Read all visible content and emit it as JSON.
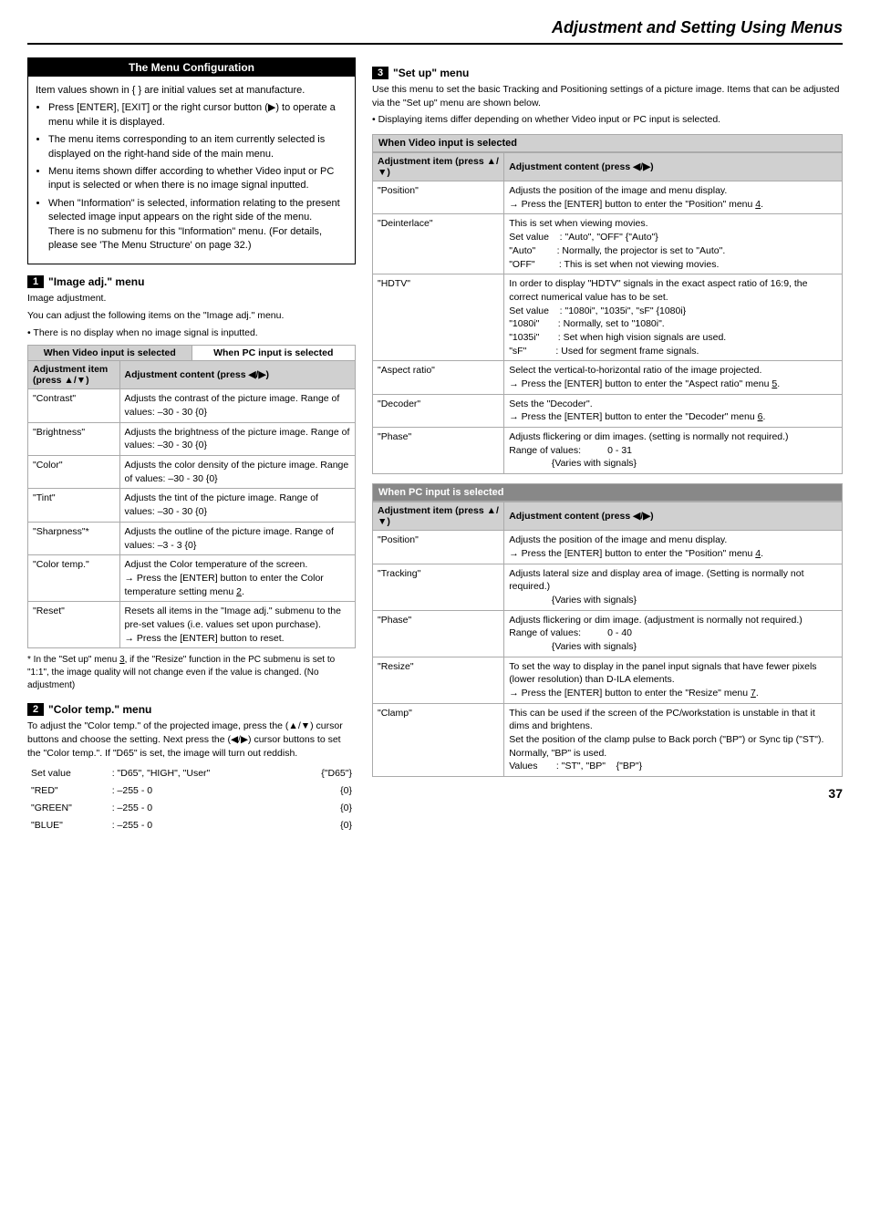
{
  "page": {
    "title": "Adjustment and Setting Using Menus",
    "number": "37"
  },
  "menu_config": {
    "title": "The Menu Configuration",
    "body_para": "Item values shown in {  } are initial values set at manufacture.",
    "bullets": [
      "Press [ENTER], [EXIT] or the right cursor button (▶) to operate a menu while it is displayed.",
      "The menu items corresponding to an item currently selected is displayed on the right-hand side of the main menu.",
      "Menu items shown differ according to whether Video input or PC input is selected or when there is no image signal inputted.",
      "When \"Information\" is selected, information relating to the present selected image input appears on the right side of the menu.",
      "There is no submenu for this \"Information\" menu. (For details, please see 'The Menu Structure' on page 32.)"
    ]
  },
  "menu1": {
    "num": "1",
    "title": "\"Image adj.\" menu",
    "desc": "Image adjustment.",
    "sub": "You can adjust the following items on the \"Image adj.\" menu.",
    "bullet": "There is no display when no image signal is inputted.",
    "tab_video": "When Video input is selected",
    "tab_pc": "When PC input is selected",
    "col1": "Adjustment item (press ▲/▼)",
    "col2": "Adjustment content (press ◀/▶)",
    "rows": [
      {
        "item": "\"Contrast\"",
        "content": "Adjusts the contrast of the picture image. Range of values: –30 - 30    {0}"
      },
      {
        "item": "\"Brightness\"",
        "content": "Adjusts the brightness of the picture image. Range of values: –30 - 30    {0}"
      },
      {
        "item": "\"Color\"",
        "content": "Adjusts the color density of the picture image. Range of values: –30 - 30    {0}"
      },
      {
        "item": "\"Tint\"",
        "content": "Adjusts the tint of the picture image. Range of values: –30 - 30    {0}"
      },
      {
        "item": "\"Sharpness\"*",
        "content": "Adjusts the outline of the picture image. Range of values: –3 - 3    {0}"
      },
      {
        "item": "\"Color temp.\"",
        "content": "Adjust the Color temperature of the screen.\n→ Press the [ENTER] button to enter the Color temperature setting menu 2."
      },
      {
        "item": "\"Reset\"",
        "content": "Resets all items in the \"Image adj.\" submenu to the pre-set values (i.e. values set upon purchase).\n→ Press the [ENTER] button to reset."
      }
    ],
    "footnote": "* In the \"Set up\" menu 3, if the \"Resize\" function in the PC submenu is set to \"1:1\", the image quality will not change even if the value is changed. (No adjustment)"
  },
  "menu2": {
    "num": "2",
    "title": "\"Color temp.\" menu",
    "desc": "To adjust the \"Color temp.\" of the projected image, press the (▲/▼) cursor buttons and choose the setting. Next press the (◀/▶) cursor buttons to set the \"Color temp.\". If \"D65\" is set, the image will turn out reddish.",
    "set_value_label": "Set value",
    "set_value": ": \"D65\", \"HIGH\", \"User\"",
    "set_value_suffix": "{\"D65\"}",
    "red_label": "\"RED\"",
    "red_value": ": –255 - 0",
    "red_suffix": "{0}",
    "green_label": "\"GREEN\"",
    "green_value": ": –255 - 0",
    "green_suffix": "{0}",
    "blue_label": "\"BLUE\"",
    "blue_value": ": –255 - 0",
    "blue_suffix": "{0}"
  },
  "menu3": {
    "num": "3",
    "title": "\"Set up\" menu",
    "desc": "Use this menu to set the basic Tracking and Positioning settings of a picture image. Items that can be adjusted via the \"Set up\" menu are shown below.",
    "bullet": "Displaying items differ depending on whether Video input or PC input is selected.",
    "when_video_label": "When Video input is selected",
    "when_pc_label": "When PC input is selected",
    "col1": "Adjustment item (press ▲/▼)",
    "col2": "Adjustment content (press ◀/▶)",
    "video_rows": [
      {
        "item": "\"Position\"",
        "content": "Adjusts the position of the image and menu display.\n→ Press the [ENTER] button to enter the \"Position\" menu 4."
      },
      {
        "item": "\"Deinterlace\"",
        "content": "This is set when viewing movies.\nSet value    : \"Auto\", \"OFF\" {\"Auto\"}\n\"Auto\"         : Normally, the projector is set to \"Auto\".\n\"OFF\"          : This is set when not viewing movies."
      },
      {
        "item": "\"HDTV\"",
        "content": "In order to display \"HDTV\" signals in the exact aspect ratio of 16:9, the correct numerical value has to be set.\nSet value    : \"1080i\", \"1035i\", \"sF\" {1080i}\n\"1080i\"       : Normally, set to \"1080i\".\n\"1035i\"       : Set when high vision signals are used.\n\"sF\"           : Used for segment frame signals."
      },
      {
        "item": "\"Aspect ratio\"",
        "content": "Select the vertical-to-horizontal ratio of the image projected.\n→ Press the [ENTER] button to enter the \"Aspect ratio\" menu 5."
      },
      {
        "item": "\"Decoder\"",
        "content": "Sets the \"Decoder\".\n→ Press the [ENTER] button to enter the \"Decoder\" menu 6."
      },
      {
        "item": "\"Phase\"",
        "content": "Adjusts flickering or dim images. (setting is normally not required.)\nRange of values:           0 - 31\n                {Varies with signals}"
      }
    ],
    "pc_rows": [
      {
        "item": "\"Position\"",
        "content": "Adjusts the position of the image and menu display.\n→ Press the [ENTER] button to enter the \"Position\" menu 4."
      },
      {
        "item": "\"Tracking\"",
        "content": "Adjusts lateral size and display area of image. (Setting is normally not required.)\n                {Varies with signals}"
      },
      {
        "item": "\"Phase\"",
        "content": "Adjusts flickering or dim image. (adjustment is normally not required.)\nRange of values:           0 - 40\n                {Varies with signals}"
      },
      {
        "item": "\"Resize\"",
        "content": "To set the way to display in the panel input signals that have fewer pixels (lower resolution) than D-ILA elements.\n→ Press the [ENTER] button to enter the \"Resize\" menu 7."
      },
      {
        "item": "\"Clamp\"",
        "content": "This can be used if the screen of the PC/workstation is unstable in that it dims and brightens.\nSet the position of the clamp pulse to Back porch (\"BP\") or Sync tip (\"ST\").\nNormally, \"BP\" is used.\nValues       : \"ST\", \"BP\"    {\"BP\"}"
      }
    ]
  }
}
